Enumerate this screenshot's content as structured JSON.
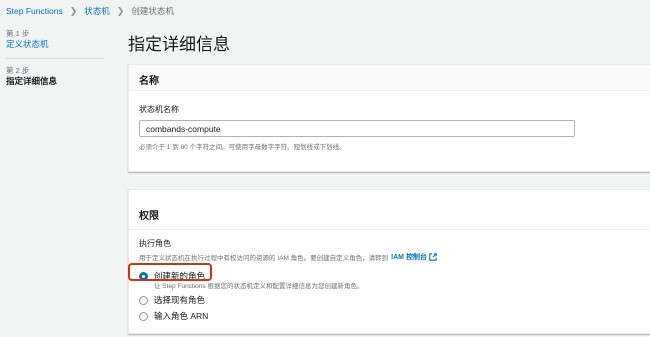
{
  "breadcrumb": {
    "items": [
      "Step Functions",
      "状态机"
    ],
    "current": "创建状态机"
  },
  "sidebar": {
    "steps": [
      {
        "num": "第 1 步",
        "title": "定义状态机"
      },
      {
        "num": "第 2 步",
        "title": "指定详细信息"
      }
    ]
  },
  "page_title": "指定详细信息",
  "name_panel": {
    "header": "名称",
    "label": "状态机名称",
    "value": "combands-compute",
    "hint": "必须介于 1 到 80 个字符之间。可使用字母数字字符、短划线或下划线。"
  },
  "permissions_panel": {
    "header": "权限",
    "label": "执行角色",
    "desc": "用于定义状态机在执行过程中有权访问的资源的 IAM 角色。要创建自定义角色，请转到",
    "iam_link": "IAM 控制台",
    "options": [
      {
        "label": "创建新的角色",
        "sub": "让 Step Functions 根据您的状态机定义和配置详细信息为您创建新角色。"
      },
      {
        "label": "选择现有角色"
      },
      {
        "label": "输入角色 ARN"
      }
    ],
    "selected": 0
  },
  "colors": {
    "link": "#0073bb",
    "highlight": "#d13212"
  }
}
